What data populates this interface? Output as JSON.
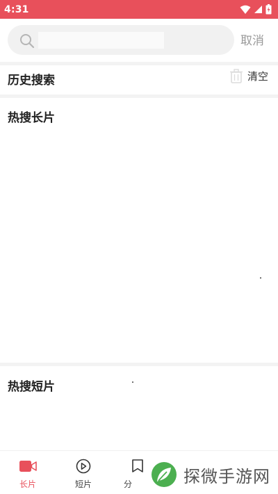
{
  "status_bar": {
    "time": "4:31",
    "icons": [
      "wifi-icon",
      "signal-icon",
      "battery-icon"
    ],
    "background": "#e8505b"
  },
  "search": {
    "value": "",
    "placeholder": "",
    "cancel_label": "取消"
  },
  "history": {
    "title": "历史搜索",
    "clear_label": "清空",
    "items": []
  },
  "hot_long": {
    "title": "热搜长片",
    "items": []
  },
  "hot_short": {
    "title": "热搜短片",
    "items": []
  },
  "bottom_nav": {
    "items": [
      {
        "label": "长片",
        "icon": "video-camera-icon",
        "active": true
      },
      {
        "label": "短片",
        "icon": "play-circle-icon",
        "active": false
      },
      {
        "label": "分",
        "icon": "category-icon",
        "active": false
      }
    ],
    "active_color": "#e8505b"
  },
  "watermark": {
    "text": "探微手游网"
  }
}
